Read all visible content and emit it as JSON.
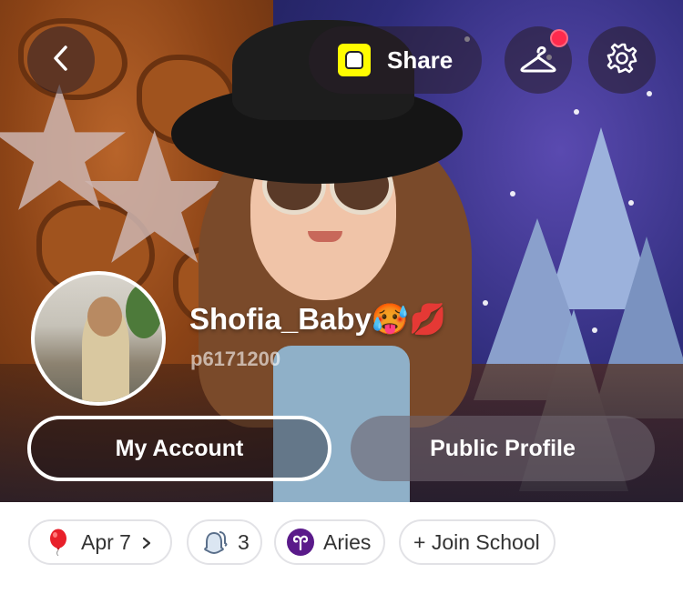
{
  "header": {
    "back_icon": "chevron-left-icon",
    "share_label": "Share",
    "hanger_icon": "hanger-icon",
    "settings_icon": "gear-icon",
    "notification_color": "#ff2a4d"
  },
  "profile": {
    "display_name": "Shofia_Baby🥵💋",
    "username": "p6171200"
  },
  "actions": {
    "my_account_label": "My Account",
    "public_profile_label": "Public Profile"
  },
  "chips": {
    "birthday_icon": "balloon-icon",
    "birthday_label": "Apr 7",
    "friends_icon": "ghost-friends-icon",
    "friends_count": "3",
    "zodiac_icon": "aries-icon",
    "zodiac_label": "Aries",
    "school_label": "+ Join School"
  },
  "colors": {
    "snapcode": "#fffc00",
    "zodiac": "#5a1a8a",
    "balloon": "#e8202a"
  }
}
